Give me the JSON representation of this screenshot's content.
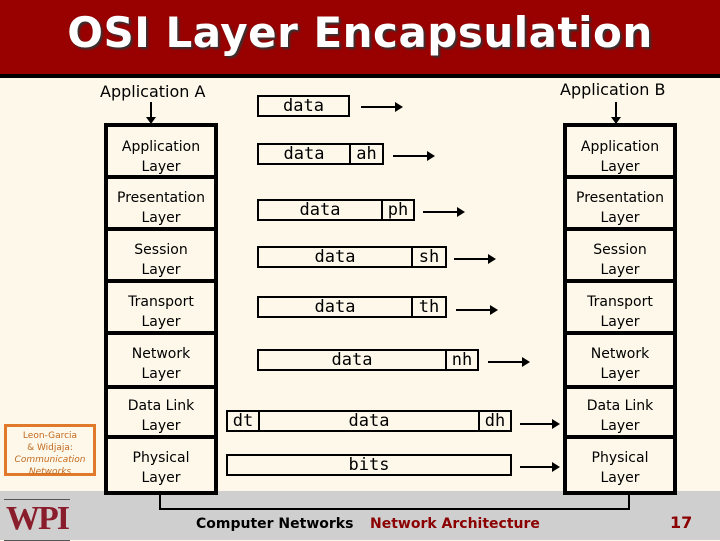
{
  "title": "OSI Layer Encapsulation",
  "app_a": "Application A",
  "app_b": "Application B",
  "layers": [
    {
      "line1": "Application",
      "line2": "Layer"
    },
    {
      "line1": "Presentation",
      "line2": "Layer"
    },
    {
      "line1": "Session",
      "line2": "Layer"
    },
    {
      "line1": "Transport",
      "line2": "Layer"
    },
    {
      "line1": "Network",
      "line2": "Layer"
    },
    {
      "line1": "Data Link",
      "line2": "Layer"
    },
    {
      "line1": "Physical",
      "line2": "Layer"
    }
  ],
  "packets": [
    {
      "data": "data",
      "header": "",
      "trailer": ""
    },
    {
      "data": "data",
      "header": "ah",
      "trailer": ""
    },
    {
      "data": "data",
      "header": "ph",
      "trailer": ""
    },
    {
      "data": "data",
      "header": "sh",
      "trailer": ""
    },
    {
      "data": "data",
      "header": "th",
      "trailer": ""
    },
    {
      "data": "data",
      "header": "nh",
      "trailer": ""
    },
    {
      "data": "data",
      "header": "dh",
      "trailer": "dt"
    },
    {
      "data": "bits",
      "header": "",
      "trailer": ""
    }
  ],
  "book": {
    "line1": "Leon-Garcia",
    "line2": "& Widjaja:",
    "line3": "Communication",
    "line4": "Networks"
  },
  "footer": {
    "logo": "WPI",
    "course": "Computer Networks",
    "topic": "Network Architecture",
    "page": "17"
  },
  "colors": {
    "title_bg": "#990000",
    "topic": "#8b0000",
    "book_border": "#e07a2a"
  }
}
